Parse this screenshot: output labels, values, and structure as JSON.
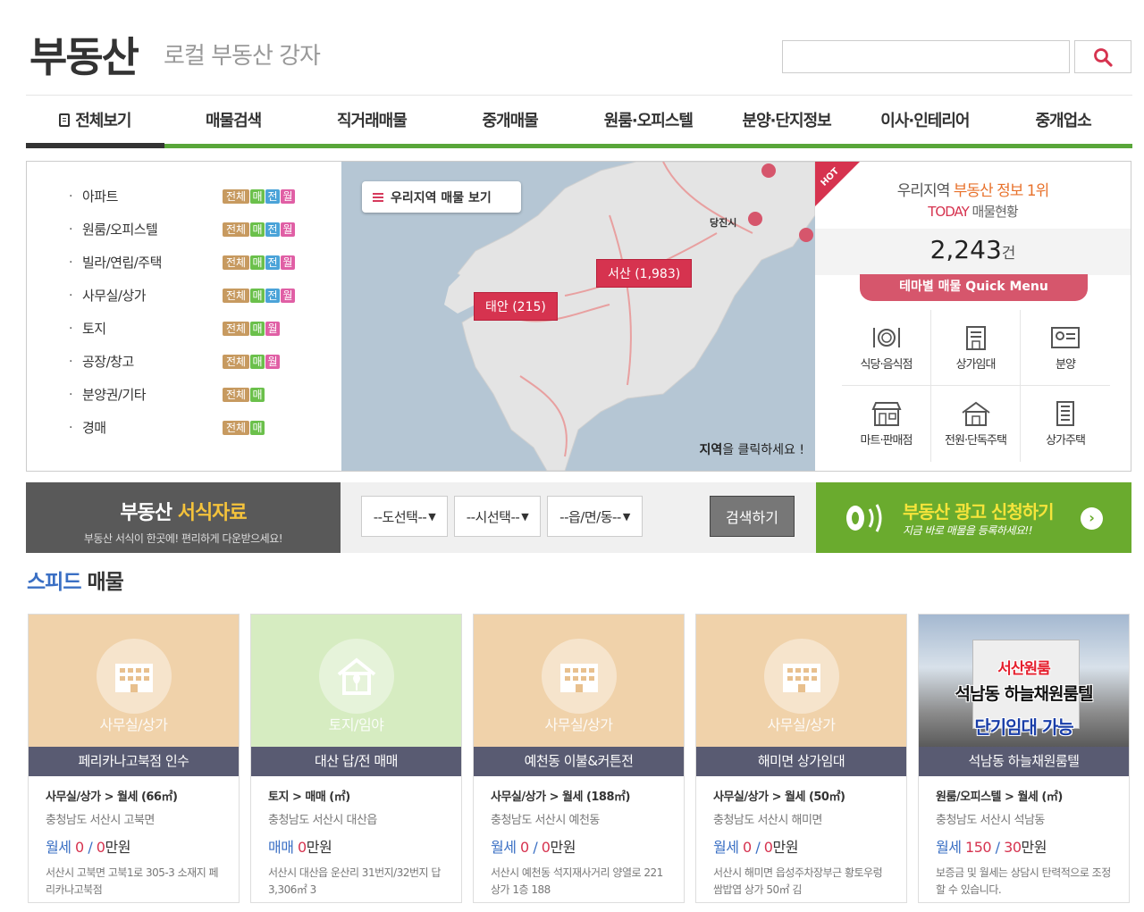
{
  "header": {
    "logo": "부동산",
    "slogan": "로컬 부동산 강자",
    "search_value": ""
  },
  "nav": {
    "items": [
      "전체보기",
      "매물검색",
      "직거래매물",
      "중개매물",
      "원룸·오피스텔",
      "분양·단지정보",
      "이사·인테리어",
      "중개업소"
    ],
    "active_index": 0
  },
  "categories": [
    {
      "name": "아파트",
      "tags": [
        "전체",
        "매",
        "전",
        "월"
      ]
    },
    {
      "name": "원룸/오피스텔",
      "tags": [
        "전체",
        "매",
        "전",
        "월"
      ]
    },
    {
      "name": "빌라/연립/주택",
      "tags": [
        "전체",
        "매",
        "전",
        "월"
      ]
    },
    {
      "name": "사무실/상가",
      "tags": [
        "전체",
        "매",
        "전",
        "월"
      ]
    },
    {
      "name": "토지",
      "tags": [
        "전체",
        "매",
        "월"
      ]
    },
    {
      "name": "공장/창고",
      "tags": [
        "전체",
        "매",
        "월"
      ]
    },
    {
      "name": "분양권/기타",
      "tags": [
        "전체",
        "매"
      ]
    },
    {
      "name": "경매",
      "tags": [
        "전체",
        "매"
      ]
    }
  ],
  "map": {
    "button_label": "우리지역 매물 보기",
    "region_labels": [
      {
        "name": "서산 (1,983)"
      },
      {
        "name": "태안 (215)"
      }
    ],
    "town_label": "당진시",
    "hint_bold": "지역",
    "hint_rest": "을 클릭하세요 !"
  },
  "today_box": {
    "hot": "HOT",
    "line1_prefix": "우리지역 ",
    "line1_highlight": "부동산 정보 1위",
    "line2_highlight": "TODAY",
    "line2_rest": " 매물현황",
    "count": "2,243",
    "count_unit": "건",
    "quick_menu_label": "테마별 매물 Quick Menu",
    "quick_menu": [
      {
        "label": "식당·음식점",
        "icon": "restaurant-icon"
      },
      {
        "label": "상가임대",
        "icon": "store-icon"
      },
      {
        "label": "분양",
        "icon": "certificate-icon"
      },
      {
        "label": "마트·판매점",
        "icon": "mart-icon"
      },
      {
        "label": "전원·단독주택",
        "icon": "house-icon"
      },
      {
        "label": "상가주택",
        "icon": "building-icon"
      }
    ]
  },
  "forms_box": {
    "title_prefix": "부동산 ",
    "title_highlight": "서식자료",
    "subtitle": "부동산 서식이 한곳에! 편리하게 다운받으세요!"
  },
  "selects": {
    "province": "--도선택--",
    "city": "--시선택--",
    "town": "--읍/면/동--",
    "search_button": "검색하기"
  },
  "ad_box": {
    "title": "부동산 광고 신청하기",
    "subtitle": "지금 바로 매물을 등록하세요!!"
  },
  "speed": {
    "title_highlight": "스피드",
    "title_rest": " 매물",
    "cards": [
      {
        "thumb_label": "사무실/상가",
        "thumb_color": "#f0d2aa",
        "title": "페리카나고북점 인수",
        "category": "사무실/상가 > 월세 (66㎡)",
        "address": "충청남도 서산시 고북면",
        "price_unit": "월세",
        "price_a": "0",
        "price_b": "0",
        "price_tail": "만원",
        "desc": "서산시 고북면 고북1로 305-3 소재지 페리카나고북점"
      },
      {
        "thumb_label": "토지/임야",
        "thumb_color": "#d6ecc1",
        "title": "대산 답/전 매매",
        "category": "토지 > 매매 (㎡)",
        "address": "충청남도 서산시 대산읍",
        "price_unit": "매매",
        "price_a": "0",
        "price_b": "",
        "price_tail": "만원",
        "desc": "서산시 대산읍 운산리 31번지/32번지 답3,306㎡ 3"
      },
      {
        "thumb_label": "사무실/상가",
        "thumb_color": "#f0d2aa",
        "title": "예천동 이불&커튼전",
        "category": "사무실/상가 > 월세 (188㎡)",
        "address": "충청남도 서산시 예천동",
        "price_unit": "월세",
        "price_a": "0",
        "price_b": "0",
        "price_tail": "만원",
        "desc": "서산시 예천동 석지재사거리 양열로 221 상가 1층 188"
      },
      {
        "thumb_label": "사무실/상가",
        "thumb_color": "#f0d2aa",
        "title": "해미면 상가임대",
        "category": "사무실/상가 > 월세 (50㎡)",
        "address": "충청남도 서산시 해미면",
        "price_unit": "월세",
        "price_a": "0",
        "price_b": "0",
        "price_tail": "만원",
        "desc": "서산시 해미면 읍성주차장부근 황토우렁쌈밥엽 상가 50㎡ 김"
      },
      {
        "thumb_label": "",
        "thumb_color": "",
        "photo_text1": "서산원룸",
        "photo_text2": "석남동 하늘채원룸텔",
        "photo_text3": "단기임대 가능",
        "title": "석남동 하늘채원룸텔",
        "category": "원룸/오피스텔 > 월세 (㎡)",
        "address": "충청남도 서산시 석남동",
        "price_unit": "월세",
        "price_a": "150",
        "price_b": "30",
        "price_tail": "만원",
        "desc": "보증금 및 월세는 상담시 탄력적으로 조정할 수 있습니다."
      }
    ]
  }
}
